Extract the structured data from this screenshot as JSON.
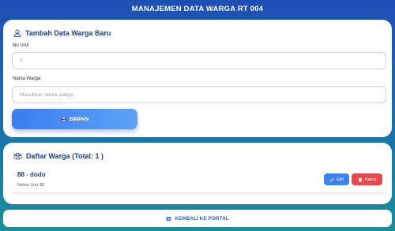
{
  "header": {
    "title": "MANAJEMEN DATA WARGA RT 004"
  },
  "form": {
    "title": "Tambah Data Warga Baru",
    "no_urut_label": "No Urut",
    "no_urut_placeholder": "1",
    "nama_label": "Nama Warga",
    "nama_placeholder": "Masukkan nama warga",
    "submit_label": "SIMPAN"
  },
  "list": {
    "title": "Daftar Warga (Total: 1 )",
    "items": [
      {
        "name": "88 - dodo",
        "sub": "Nomor Urut: 88",
        "edit_label": "Edit",
        "delete_label": "Hapus"
      }
    ]
  },
  "footer": {
    "back_label": "KEMBALI KE PORTAL"
  },
  "colors": {
    "primary": "#3b7cf0",
    "title": "#1e3f8a",
    "danger": "#e8474d",
    "background_top": "#1e4fb4",
    "background_bottom": "#1a8f9a"
  },
  "icons": {
    "form_title": "user-icon",
    "list_title": "users-icon",
    "submit": "save-icon",
    "edit": "pencil-icon",
    "delete": "trash-icon",
    "back": "portal-icon"
  }
}
